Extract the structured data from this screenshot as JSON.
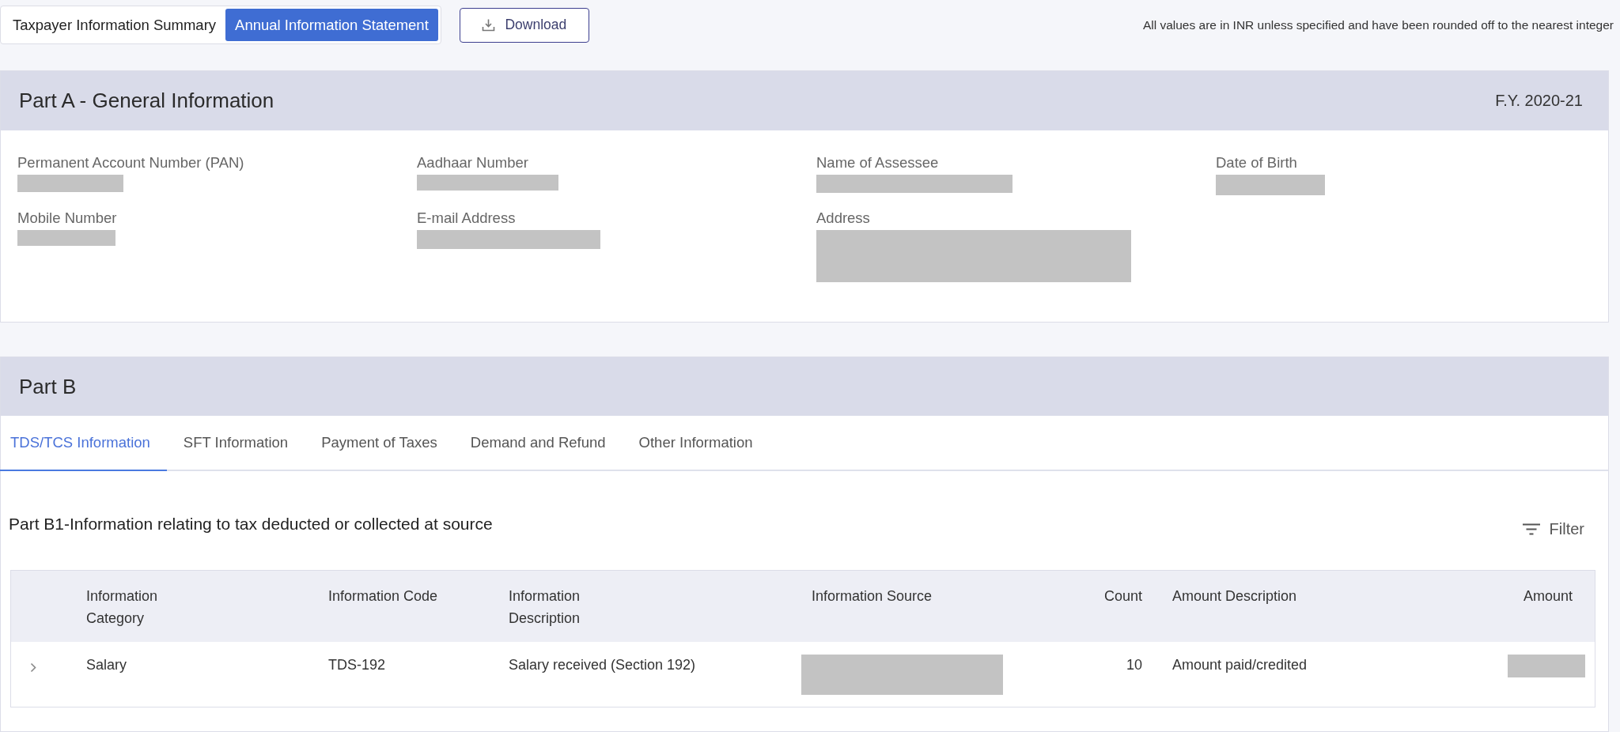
{
  "view_toggle": [
    {
      "label": "Taxpayer Information Summary",
      "selected": false
    },
    {
      "label": "Annual Information Statement",
      "selected": true
    }
  ],
  "download_button": {
    "label": "Download"
  },
  "note": "All values are in INR unless specified and have been rounded off to the nearest integer",
  "part_a": {
    "title": "Part A - General Information",
    "fiscal_year": "F.Y. 2020-21",
    "fields": [
      {
        "label": "Permanent Account Number (PAN)",
        "redacted": true
      },
      {
        "label": "Aadhaar Number",
        "redacted": true
      },
      {
        "label": "Name of Assessee",
        "redacted": true
      },
      {
        "label": "Date of Birth",
        "redacted": true
      },
      {
        "label": "Mobile Number",
        "redacted": true
      },
      {
        "label": "E-mail Address",
        "redacted": true
      },
      {
        "label": "Address",
        "redacted": true
      }
    ]
  },
  "part_b": {
    "title": "Part B",
    "tabs": [
      {
        "label": "TDS/TCS Information",
        "selected": true
      },
      {
        "label": "SFT Information",
        "selected": false
      },
      {
        "label": "Payment of Taxes",
        "selected": false
      },
      {
        "label": "Demand and Refund",
        "selected": false
      },
      {
        "label": "Other Information",
        "selected": false
      }
    ],
    "section_title": "Part B1-Information relating to tax deducted or collected at source",
    "filter_button": {
      "label": "Filter"
    },
    "table": {
      "columns": [
        "Information Category",
        "Information Code",
        "Information Description",
        "Information Source",
        "Count",
        "Amount Description",
        "Amount"
      ],
      "rows": [
        {
          "expanded": false,
          "cells": [
            {
              "text": "Salary"
            },
            {
              "text": "TDS-192"
            },
            {
              "text": "Salary received (Section 192)"
            },
            {
              "redacted": true
            },
            {
              "text": "10"
            },
            {
              "text": "Amount paid/credited"
            },
            {
              "redacted": true
            }
          ]
        }
      ]
    }
  }
}
